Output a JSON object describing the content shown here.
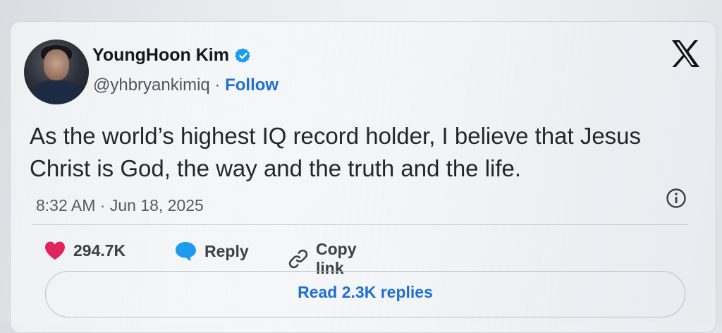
{
  "author": {
    "name": "YoungHoon Kim",
    "handle": "@yhbryankimiq",
    "separator": " · ",
    "follow_label": "Follow"
  },
  "tweet": {
    "text": "As the world’s highest IQ record holder, I believe that Jesus Christ is God, the way and the truth and the life.",
    "timestamp": "8:32 AM · Jun 18, 2025"
  },
  "actions": {
    "like_count": "294.7K",
    "reply_label": "Reply",
    "copy_label": "Copy link"
  },
  "read_replies_label": "Read 2.3K replies",
  "colors": {
    "accent_blue": "#1d6fd1",
    "heart_red": "#e0245e",
    "reply_blue": "#1d9bf0",
    "text_dark": "#14171a"
  },
  "icons": [
    "verified-badge-icon",
    "x-logo-icon",
    "info-icon",
    "heart-icon",
    "reply-bubble-icon",
    "link-icon"
  ]
}
